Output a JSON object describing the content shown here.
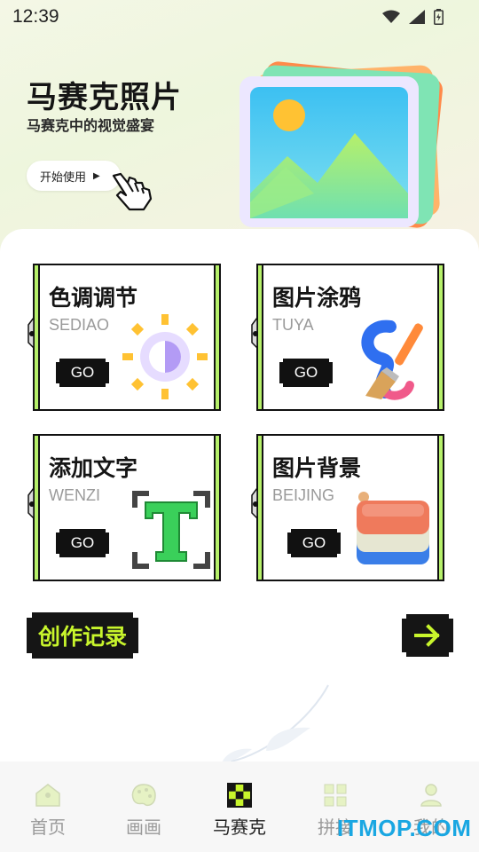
{
  "status_bar": {
    "time": "12:39"
  },
  "hero": {
    "title": "马赛克照片",
    "subtitle": "马赛克中的视觉盛宴",
    "start_button": "开始使用"
  },
  "cards": [
    {
      "title": "色调调节",
      "subtitle": "SEDIAO",
      "go": "GO",
      "icon": "sun-contrast-icon"
    },
    {
      "title": "图片涂鸦",
      "subtitle": "TUYA",
      "go": "GO",
      "icon": "paintbrush-icon"
    },
    {
      "title": "添加文字",
      "subtitle": "WENZI",
      "go": "GO",
      "icon": "text-T-icon"
    },
    {
      "title": "图片背景",
      "subtitle": "BEIJING",
      "go": "GO",
      "icon": "layers-icon"
    }
  ],
  "history": {
    "label": "创作记录"
  },
  "bottom_nav": {
    "items": [
      {
        "label": "首页",
        "icon": "home-icon"
      },
      {
        "label": "画画",
        "icon": "palette-icon"
      },
      {
        "label": "马赛克",
        "icon": "mosaic-icon",
        "active": true
      },
      {
        "label": "拼接",
        "icon": "grid-icon"
      },
      {
        "label": "我的",
        "icon": "user-icon"
      }
    ]
  },
  "watermark": "ITMOP.COM",
  "colors": {
    "accent": "#c8f52c",
    "dark": "#151515",
    "card_edge": "#b6f06a"
  }
}
